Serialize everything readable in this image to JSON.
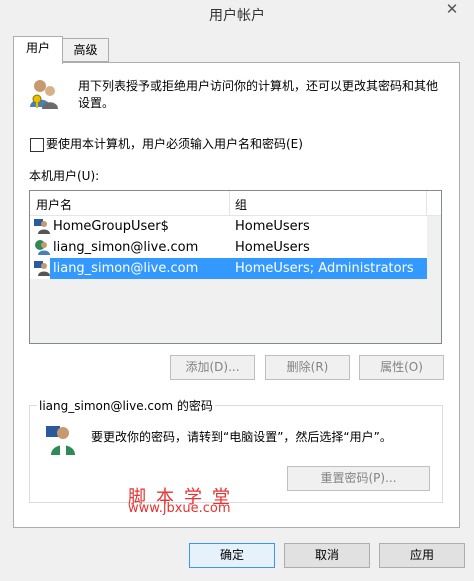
{
  "window": {
    "title": "用户帐户",
    "close_glyph": "✕"
  },
  "tabs": [
    {
      "label": "用户",
      "active": true
    },
    {
      "label": "高级",
      "active": false
    }
  ],
  "intro_text": "用下列表授予或拒绝用户访问你的计算机，还可以更改其密码和其他设置。",
  "require_password_checkbox": {
    "label": "要使用本计算机，用户必须输入用户名和密码(E)",
    "checked": false
  },
  "local_users": {
    "label": "本机用户(U):",
    "columns": [
      "用户名",
      "组"
    ],
    "rows": [
      {
        "name": "HomeGroupUser$",
        "group": "HomeUsers",
        "icon": "user-icon",
        "selected": false
      },
      {
        "name": "liang_simon@live.com",
        "group": "HomeUsers",
        "icon": "microsoft-account-icon",
        "selected": false
      },
      {
        "name": "liang_simon@live.com",
        "group": "HomeUsers; Administrators",
        "icon": "user-icon",
        "selected": true
      }
    ]
  },
  "buttons": {
    "add": "添加(D)...",
    "remove": "删除(R)",
    "properties": "属性(O)"
  },
  "password_group": {
    "title": "liang_simon@live.com 的密码",
    "message": "要更改你的密码，请转到“电脑设置”，然后选择“用户”。",
    "reset_button": "重置密码(P)..."
  },
  "watermark": {
    "line1": "脚本学堂",
    "line2": "www.jbxue.com"
  },
  "footer": {
    "ok": "确定",
    "cancel": "取消",
    "apply": "应用"
  },
  "colors": {
    "selection": "#3399ff",
    "watermark": "#e63232"
  }
}
